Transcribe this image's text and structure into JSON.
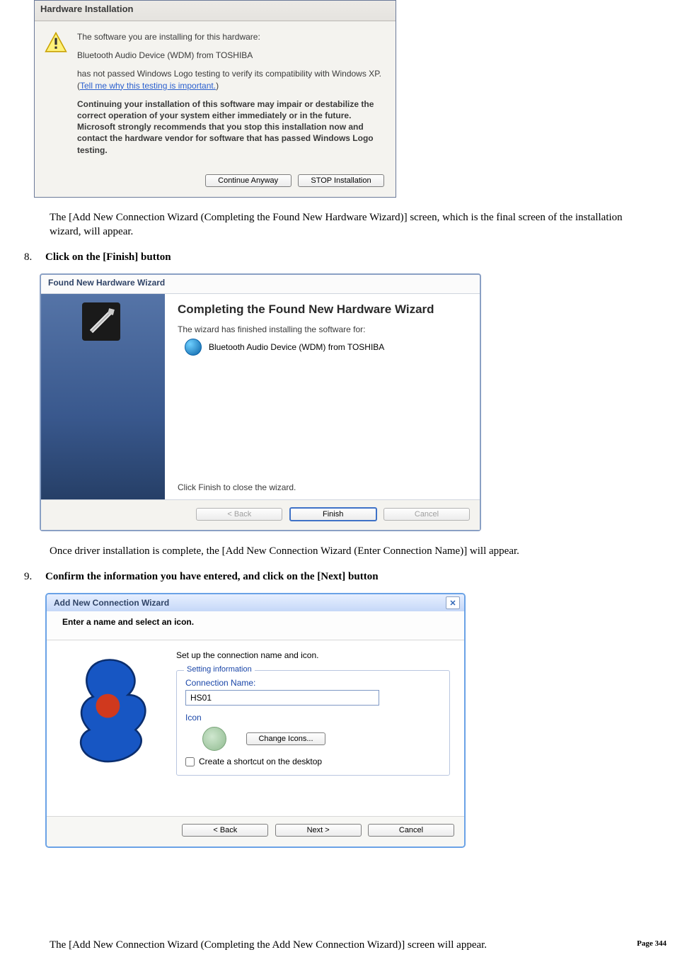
{
  "dlg1": {
    "title": "Hardware Installation",
    "line1": "The software you are installing for this hardware:",
    "device": "Bluetooth Audio Device (WDM) from TOSHIBA",
    "logo_line_a": "has not passed Windows Logo testing to verify its compatibility with Windows XP. (",
    "logo_link": "Tell me why this testing is important.",
    "logo_line_b": ")",
    "warn_para": "Continuing your installation of this software may impair or destabilize the correct operation of your system either immediately or in the future. Microsoft strongly recommends that you stop this installation now and contact the hardware vendor for software that has passed Windows Logo testing.",
    "btn_continue": "Continue Anyway",
    "btn_stop": "STOP Installation"
  },
  "para1": "The [Add New Connection Wizard (Completing the Found New Hardware Wizard)] screen, which is the final screen of the installation wizard, will appear.",
  "step8": {
    "num": "8.",
    "text": "Click on the [Finish] button"
  },
  "dlg2": {
    "title": "Found New Hardware Wizard",
    "heading": "Completing the Found New Hardware Wizard",
    "subline": "The wizard has finished installing the software for:",
    "device": "Bluetooth Audio Device (WDM) from TOSHIBA",
    "close_line": "Click Finish to close the wizard.",
    "btn_back": "< Back",
    "btn_finish": "Finish",
    "btn_cancel": "Cancel"
  },
  "para2": "Once driver installation is complete, the [Add New Connection Wizard (Enter Connection Name)] will appear.",
  "step9": {
    "num": "9.",
    "text": "Confirm the information you have entered, and click on the [Next] button"
  },
  "dlg3": {
    "title": "Add New Connection Wizard",
    "subhead": "Enter a name and select an icon.",
    "setup_line": "Set up the connection name and icon.",
    "legend": "Setting information",
    "conn_label": "Connection Name:",
    "conn_value": "HS01",
    "icon_label": "Icon",
    "change_icons": "Change Icons...",
    "create_shortcut": "Create a shortcut on the desktop",
    "btn_back": "< Back",
    "btn_next": "Next >",
    "btn_cancel": "Cancel"
  },
  "footer": {
    "left": "The [Add New Connection Wizard (Completing the Add New Connection Wizard)] screen will appear.",
    "right": "Page 344"
  }
}
